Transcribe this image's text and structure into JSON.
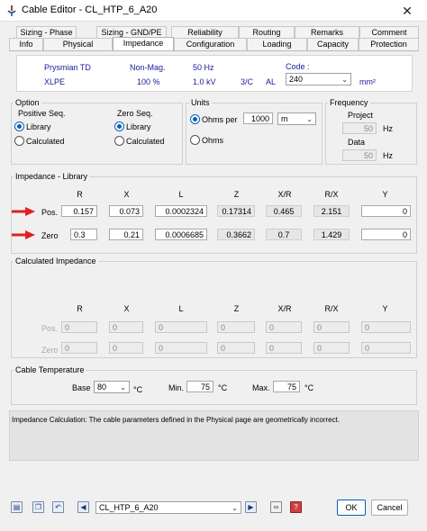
{
  "window": {
    "title": "Cable Editor - CL_HTP_6_A20"
  },
  "tabs_row1": [
    "Sizing - Phase",
    "Sizing - GND/PE",
    "Reliability",
    "Routing",
    "Remarks",
    "Comment"
  ],
  "tabs_row2": [
    "Info",
    "Physical",
    "Impedance",
    "Configuration",
    "Loading",
    "Capacity",
    "Protection"
  ],
  "active_tab": "Impedance",
  "info": {
    "manufacturer": "Prysmian TD",
    "magnetic": "Non-Mag.",
    "frequency": "50 Hz",
    "code_label": "Code :",
    "insulation": "XLPE",
    "percent": "100 %",
    "voltage": "1.0 kV",
    "conductors": "3/C",
    "material": "AL",
    "code_value": "240",
    "unit": "mm²"
  },
  "option": {
    "title": "Option",
    "positive_label": "Positive Seq.",
    "zero_label": "Zero Seq.",
    "library": "Library",
    "calculated": "Calculated"
  },
  "units": {
    "title": "Units",
    "ohms_per": "Ohms per",
    "length": "1000",
    "length_unit": "m",
    "ohms": "Ohms"
  },
  "frequency": {
    "title": "Frequency",
    "project_label": "Project",
    "project_value": "50",
    "data_label": "Data",
    "data_value": "50",
    "hz": "Hz"
  },
  "headers": [
    "R",
    "X",
    "L",
    "Z",
    "X/R",
    "R/X",
    "Y"
  ],
  "impedance_library": {
    "title": "Impedance - Library",
    "pos_label": "Pos.",
    "zero_label": "Zero",
    "pos": [
      "0.157",
      "0.073",
      "0.0002324",
      "0.17314",
      "0.465",
      "2.151",
      "0"
    ],
    "zero": [
      "0.3",
      "0.21",
      "0.0006685",
      "0.3662",
      "0.7",
      "1.429",
      "0"
    ]
  },
  "calculated_impedance": {
    "title": "Calculated Impedance",
    "pos_label": "Pos.",
    "zero_label": "Zero",
    "pos": [
      "0",
      "0",
      "0",
      "0",
      "0",
      "0",
      "0"
    ],
    "zero": [
      "0",
      "0",
      "0",
      "0",
      "0",
      "0",
      "0"
    ]
  },
  "temperature": {
    "title": "Cable Temperature",
    "base_label": "Base",
    "base_value": "80",
    "min_label": "Min.",
    "min_value": "75",
    "max_label": "Max.",
    "max_value": "75",
    "unit": "°C"
  },
  "message": "Impedance Calculation: The cable parameters defined in the Physical page are geometrically incorrect.",
  "footer": {
    "cable_id": "CL_HTP_6_A20",
    "ok": "OK",
    "cancel": "Cancel"
  },
  "colors": {
    "accent": "#0a5fb4",
    "arrow": "#e02020",
    "info_text": "#1a1a9a"
  }
}
